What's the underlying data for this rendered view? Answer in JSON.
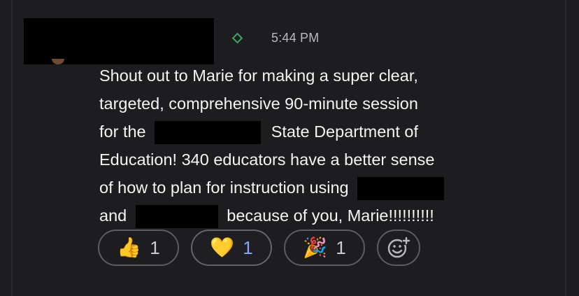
{
  "message": {
    "timestamp": "5:44 PM",
    "lines": [
      {
        "text": "Shout out to Marie for making a super clear,"
      },
      {
        "text": "targeted, comprehensive 90-minute session"
      },
      {
        "before": "for the",
        "after": "State Department of"
      },
      {
        "text": "Education! 340 educators have a better sense"
      },
      {
        "before": "of how to plan for instruction using",
        "after": ""
      },
      {
        "before": "and",
        "after": "because of you, Marie!!!!!!!!!!"
      }
    ]
  },
  "reactions": [
    {
      "emoji": "👍",
      "emoji_name": "thumbs-up-emoji",
      "count": "1",
      "active": false
    },
    {
      "emoji": "💛",
      "emoji_name": "yellow-heart-emoji",
      "count": "1",
      "active": true
    },
    {
      "emoji": "🎉",
      "emoji_name": "party-popper-emoji",
      "count": "1",
      "active": false
    }
  ],
  "add_reaction_icon": "add-reaction-icon",
  "colors": {
    "background": "#1d1d20",
    "text": "#f4f4f4",
    "timestamp": "#b7b9bf",
    "diamond": "#3aa66a",
    "active_count": "#7fa6ff"
  }
}
